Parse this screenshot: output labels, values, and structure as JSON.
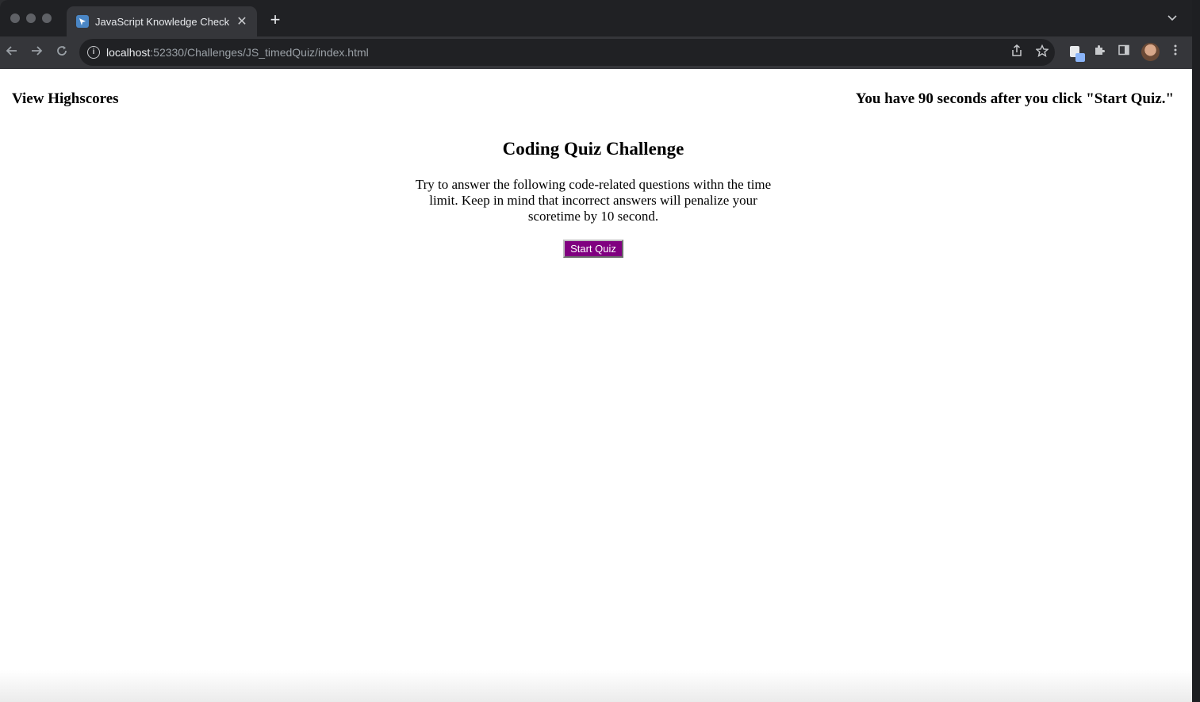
{
  "browser": {
    "tab_title": "JavaScript Knowledge Check",
    "tab_close": "✕",
    "new_tab": "+",
    "url_host": "localhost",
    "url_rest": ":52330/Challenges/JS_timedQuiz/index.html"
  },
  "page": {
    "view_highscores": "View Highscores",
    "timer_text": "You have 90 seconds after you click \"Start Quiz.\"",
    "title": "Coding Quiz Challenge",
    "intro": "Try to answer the following code-related questions withn the time limit. Keep in mind that incorrect answers will penalize your scoretime by 10 second.",
    "start_button": "Start Quiz"
  },
  "colors": {
    "start_button_bg": "#800080",
    "page_bg": "#ffffff",
    "chrome_bg": "#202124"
  }
}
